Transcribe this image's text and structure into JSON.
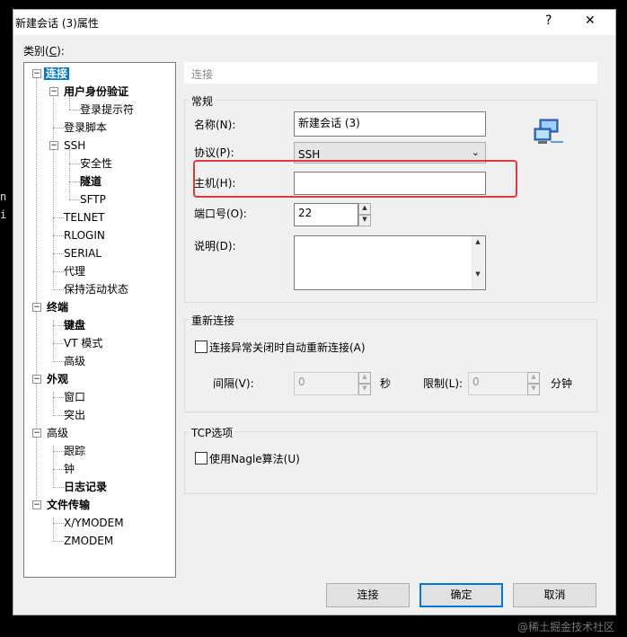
{
  "window": {
    "title": "新建会话 (3)属性",
    "help": "?",
    "close": "✕"
  },
  "stray": [
    "n",
    "i"
  ],
  "category_label": "类别(",
  "category_key": "C",
  "category_suffix": "):",
  "tree": {
    "connect": "连接",
    "auth": "用户身份验证",
    "login_prompt": "登录提示符",
    "login_script": "登录脚本",
    "ssh": "SSH",
    "security": "安全性",
    "tunnel": "隧道",
    "sftp": "SFTP",
    "telnet": "TELNET",
    "rlogin": "RLOGIN",
    "serial": "SERIAL",
    "proxy": "代理",
    "keepalive": "保持活动状态",
    "terminal": "终端",
    "keyboard": "键盘",
    "vt_mode": "VT 模式",
    "terminal_advanced": "高级",
    "appearance": "外观",
    "window": "窗口",
    "highlight": "突出",
    "advanced": "高级",
    "trace": "跟踪",
    "bell": "钟",
    "logging": "日志记录",
    "file_transfer": "文件传输",
    "xymodem": "X/YMODEM",
    "zmodem": "ZMODEM"
  },
  "panel_header": "连接",
  "general": {
    "title": "常规",
    "name_label": "名称(N):",
    "name_value": "新建会话 (3)",
    "protocol_label": "协议(P):",
    "protocol_value": "SSH",
    "host_label": "主机(H):",
    "host_value": "",
    "port_label": "端口号(O):",
    "port_value": "22",
    "desc_label": "说明(D):",
    "desc_value": ""
  },
  "reconnect": {
    "title": "重新连接",
    "checkbox_label": "连接异常关闭时自动重新连接(A)",
    "interval_label": "间隔(V):",
    "interval_value": "0",
    "interval_unit": "秒",
    "limit_label": "限制(L):",
    "limit_value": "0",
    "limit_unit": "分钟"
  },
  "tcp": {
    "title": "TCP选项",
    "nagle_label": "使用Nagle算法(U)"
  },
  "buttons": {
    "connect": "连接",
    "ok": "确定",
    "cancel": "取消"
  },
  "watermark": "@稀土掘金技术社区"
}
